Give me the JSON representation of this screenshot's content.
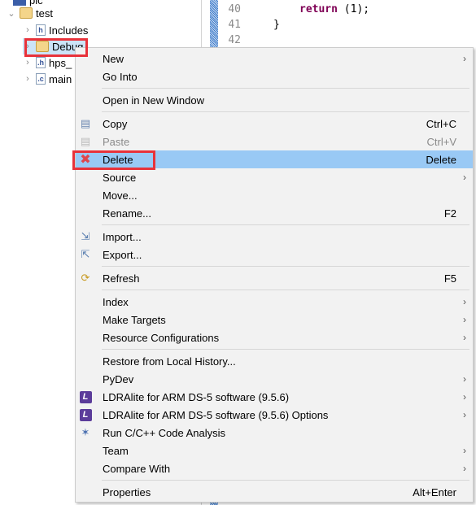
{
  "tree": {
    "items": [
      {
        "label": "pic",
        "expanded": false
      },
      {
        "label": "test",
        "expanded": true
      },
      {
        "label": "Includes",
        "expanded": false
      },
      {
        "label": "Debug",
        "expanded": false
      },
      {
        "label": "hps_",
        "expanded": false
      },
      {
        "label": "main",
        "expanded": false
      }
    ]
  },
  "editor": {
    "lines": [
      {
        "num": "40",
        "code": "return (1);"
      },
      {
        "num": "41",
        "code": "}"
      },
      {
        "num": "42",
        "code": ""
      }
    ],
    "keyword": "return",
    "code_rest": " (1);"
  },
  "menu": {
    "items": [
      {
        "label": "New",
        "submenu": true
      },
      {
        "label": "Go Into"
      },
      {
        "label": "Open in New Window"
      },
      {
        "label": "Copy",
        "shortcut": "Ctrl+C",
        "icon": "copy-icon"
      },
      {
        "label": "Paste",
        "shortcut": "Ctrl+V",
        "icon": "paste-icon",
        "disabled": true
      },
      {
        "label": "Delete",
        "shortcut": "Delete",
        "icon": "delete-icon",
        "highlighted": true
      },
      {
        "label": "Source",
        "submenu": true
      },
      {
        "label": "Move..."
      },
      {
        "label": "Rename...",
        "shortcut": "F2"
      },
      {
        "label": "Import...",
        "icon": "import-icon"
      },
      {
        "label": "Export...",
        "icon": "export-icon"
      },
      {
        "label": "Refresh",
        "shortcut": "F5",
        "icon": "refresh-icon"
      },
      {
        "label": "Index",
        "submenu": true
      },
      {
        "label": "Make Targets",
        "submenu": true
      },
      {
        "label": "Resource Configurations",
        "submenu": true
      },
      {
        "label": "Restore from Local History..."
      },
      {
        "label": "PyDev",
        "submenu": true
      },
      {
        "label": "LDRAlite for ARM DS-5 software (9.5.6)",
        "submenu": true,
        "icon": "ldra-icon"
      },
      {
        "label": "LDRAlite for ARM DS-5 software (9.5.6) Options",
        "submenu": true,
        "icon": "ldra-icon"
      },
      {
        "label": "Run C/C++ Code Analysis",
        "icon": "code-analysis-icon"
      },
      {
        "label": "Team",
        "submenu": true
      },
      {
        "label": "Compare With",
        "submenu": true
      },
      {
        "label": "Properties",
        "shortcut": "Alt+Enter"
      }
    ]
  },
  "colors": {
    "highlight": "#99c9f5",
    "annotation": "#e8323a",
    "keyword": "#7f0055"
  }
}
